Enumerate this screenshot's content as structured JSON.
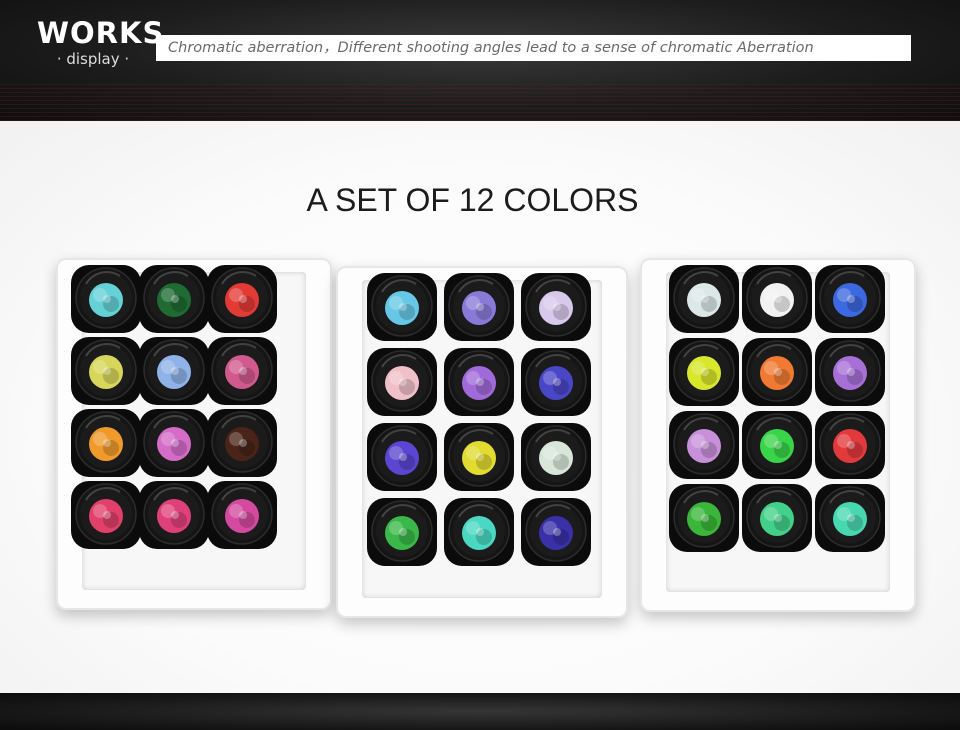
{
  "header": {
    "brand": "WORKS",
    "subtitle": "· display ·",
    "tagline": "Chromatic aberration，Different shooting angles lead to a sense of chromatic Aberration"
  },
  "photo": {
    "heading": "A SET OF 12 COLORS",
    "trays": [
      {
        "colors": [
          "#63d1d6",
          "#1f6b33",
          "#e23a35",
          "#d7d65a",
          "#8fb2e8",
          "#d05a8e",
          "#f09a2c",
          "#d46cc8",
          "#4a2418",
          "#e0406a",
          "#e0407a",
          "#d44aa0"
        ]
      },
      {
        "colors": [
          "#66c8e6",
          "#8a7ad8",
          "#d8c8ec",
          "#f0c0c8",
          "#a06ad8",
          "#4a46c8",
          "#5a46d0",
          "#e2dc30",
          "#d8e6da",
          "#3bb84a",
          "#4ad8c2",
          "#3a30a8"
        ]
      },
      {
        "colors": [
          "#dce8e8",
          "#f2f2f2",
          "#3c68e0",
          "#d8e62c",
          "#f07a32",
          "#a870d6",
          "#c890d8",
          "#3ad44a",
          "#e23a3c",
          "#3bb53a",
          "#42d08a",
          "#48d8b0"
        ]
      }
    ]
  }
}
